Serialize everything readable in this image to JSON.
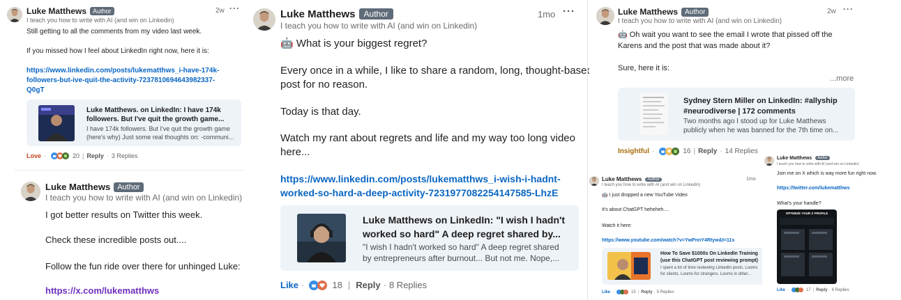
{
  "common": {
    "author_name": "Luke Matthews",
    "author_badge": "Author",
    "headline": "I teach you how to write with AI (and win on Linkedin)",
    "reply_label": "Reply",
    "more_label": "...more"
  },
  "c1": {
    "time": "2w",
    "lines": [
      "Still getting to all the comments from my video last week.",
      "If you missed how I feel about LinkedIn right now, here it is:"
    ],
    "link_lines": [
      "https://www.linkedin.com/posts/lukematthws_i-have-174k-",
      "followers-but-ive-quit-the-activity-7237810694643982337-",
      "Q0gT"
    ],
    "preview_title": [
      "Luke Matthews. on LinkedIn: I have 174k",
      "followers. But I've quit the growth game..."
    ],
    "preview_desc": [
      "I have 174k followers. But I've quit the growth game",
      "(here's why) Just some real thoughts on: -communi..."
    ],
    "reaction": "Love",
    "count": "20",
    "replies": "3 Replies"
  },
  "c2": {
    "lines": [
      "I got better results on Twitter this week.",
      "Check these incredible posts out....",
      "Follow the fun ride over there for unhinged Luke:"
    ],
    "link": "https://x.com/lukematthws"
  },
  "c3": {
    "time": "1mo",
    "lines": [
      "🤖 What is your biggest regret?",
      "Every once in a while, I like to share a random, long, thought-based",
      "post for no reason.",
      "Today is that day.",
      "Watch my rant about regrets and life and my way too long video",
      "here..."
    ],
    "link_lines": [
      "https://www.linkedin.com/posts/lukematthws_i-wish-i-hadnt-",
      "worked-so-hard-a-deep-activity-7231977082254147585-LhzE"
    ],
    "preview_title": [
      "Luke Matthews on LinkedIn: \"I wish I hadn't",
      "worked so hard\" A deep regret shared by..."
    ],
    "preview_desc": [
      "\"I wish I hadn't worked so hard\" A deep regret shared",
      "by entrepreneurs after burnout... But not me. Nope,..."
    ],
    "reaction": "Like",
    "count": "18",
    "replies": "8 Replies"
  },
  "c4": {
    "time": "2w",
    "lines": [
      "🤖 Oh wait you want to see the email I wrote that pissed off the",
      "Karens and the post that was made about it?",
      "Sure, here it is:"
    ],
    "preview_title": [
      "Sydney Stern Miller on LinkedIn: #allyship",
      "#neurodiverse | 172 comments"
    ],
    "preview_desc": [
      "Two months ago I stood up for Luke Matthews",
      "publicly when he was banned for the 7th time on..."
    ],
    "reaction": "Insightful",
    "count": "16",
    "replies": "14 Replies"
  },
  "c5": {
    "time": "1mo",
    "lines": [
      "🤖 I just dropped a new YouTube Video",
      "It's about ChatGPT heheheh....",
      "Watch it here:"
    ],
    "link": "https://www.youtube.com/watch?v=YwPnnY4Rtyw&t=11s",
    "preview_title": [
      "How To Save $1000s On LinkedIn Training",
      "(use this ChatGPT post reviewing prompt)"
    ],
    "preview_desc": [
      "I spent a lot of time reviewing LinkedIn posts. Looms",
      "for clients. Looms for strangers. Looms in other..."
    ],
    "reaction": "Like",
    "count": "15",
    "replies": "5 Replies"
  },
  "c6": {
    "lines": [
      "Join me on X which is way more fun right now.",
      "What's your handle?"
    ],
    "link": "https://twitter.com/lukematthws",
    "reaction": "Like",
    "count": "17",
    "replies": "6 Replies",
    "image_text": "OPTIMIZE YOUR X PROFILE"
  },
  "colors": {
    "link_blue": "#0a66c2",
    "link_purple": "#6d2fbd",
    "badge_bg": "#5e6b78",
    "preview_bg": "#eef3f8",
    "love_red": "#c3411d",
    "insightful_gold": "#a86d0b"
  },
  "icons": [
    "avatar",
    "more-options-icon",
    "robot-emoji-icon",
    "like-reaction-icon",
    "love-reaction-icon",
    "celebrate-reaction-icon",
    "insightful-reaction-icon"
  ]
}
